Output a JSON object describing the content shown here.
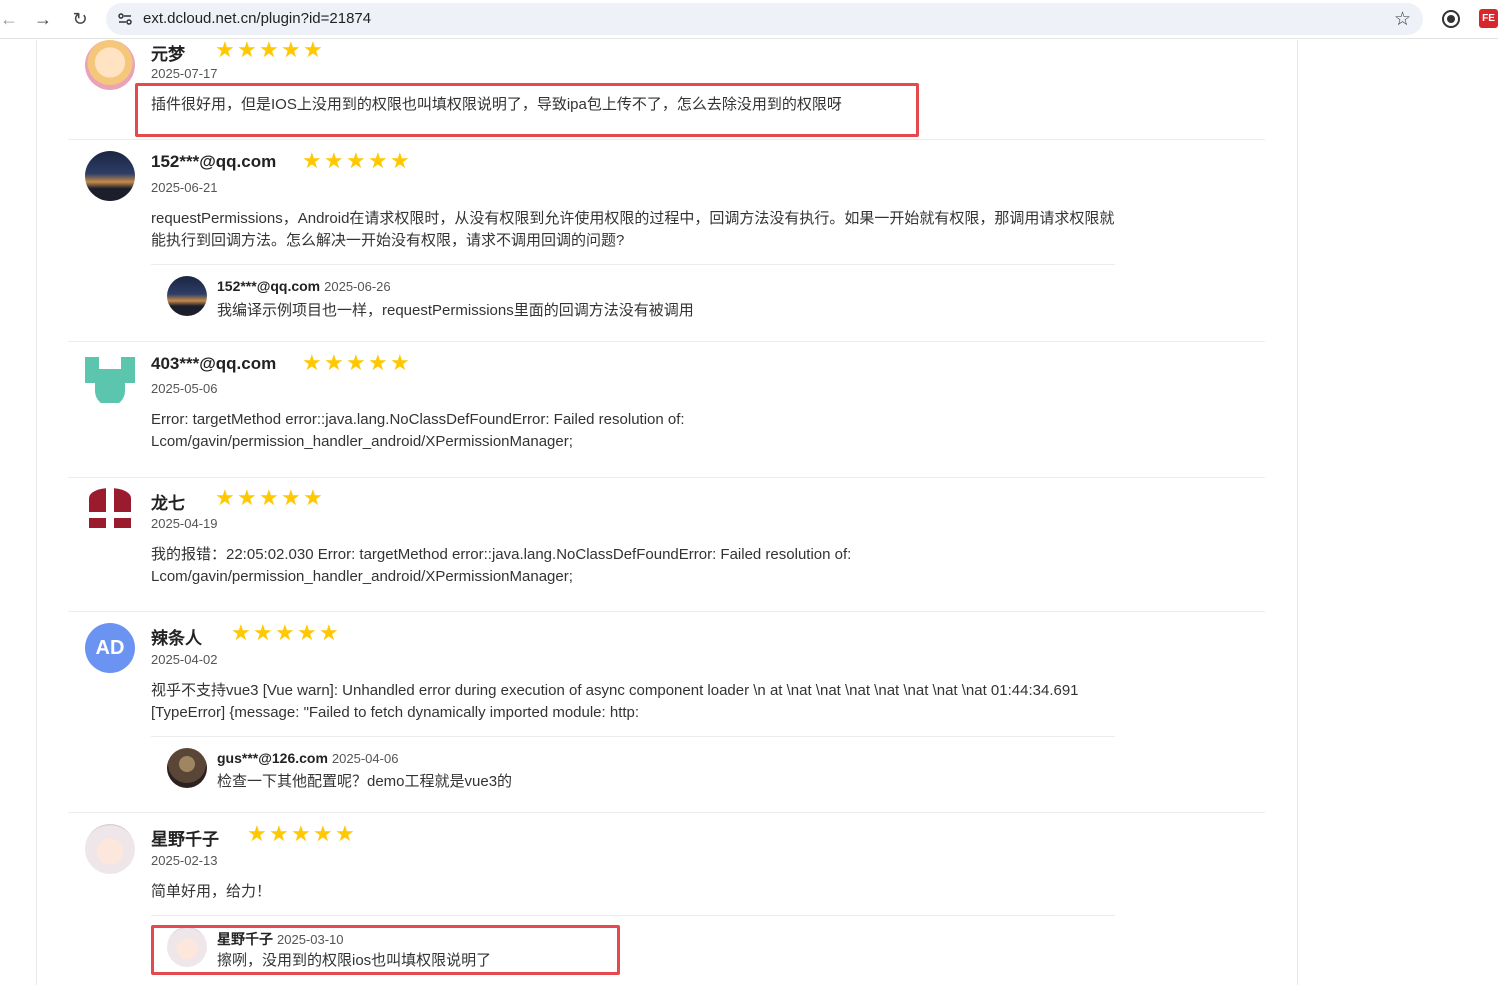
{
  "browser": {
    "url": "ext.dcloud.net.cn/plugin?id=21874",
    "back_icon": "arrow-left-icon",
    "forward_icon": "arrow-right-icon",
    "reload_icon": "reload-icon",
    "site_info_icon": "tune-icon",
    "bookmark_icon": "star-outline-icon",
    "extensions": [
      "circle-extension-icon",
      "fe-extension-icon"
    ],
    "ext2_label": "FE"
  },
  "reviews": [
    {
      "user": "元梦",
      "date": "2025-07-17",
      "rating": 5,
      "content": "插件很好用，但是IOS上没用到的权限也叫填权限说明了，导致ipa包上传不了，怎么去除没用到的权限呀",
      "highlighted": true
    },
    {
      "user": "152***@qq.com",
      "date": "2025-06-21",
      "rating": 5,
      "content": "requestPermissions，Android在请求权限时，从没有权限到允许使用权限的过程中，回调方法没有执行。如果一开始就有权限，那调用请求权限就能执行到回调方法。怎么解决一开始没有权限，请求不调用回调的问题?",
      "reply": {
        "user": "152***@qq.com",
        "date": "2025-06-26",
        "content": "我编译示例项目也一样，requestPermissions里面的回调方法没有被调用"
      }
    },
    {
      "user": "403***@qq.com",
      "date": "2025-05-06",
      "rating": 5,
      "content": "Error: targetMethod error::java.lang.NoClassDefFoundError: Failed resolution of: Lcom/gavin/permission_handler_android/XPermissionManager;"
    },
    {
      "user": "龙七",
      "date": "2025-04-19",
      "rating": 5,
      "content": "我的报错：22:05:02.030 Error: targetMethod error::java.lang.NoClassDefFoundError: Failed resolution of: Lcom/gavin/permission_handler_android/XPermissionManager;"
    },
    {
      "user": "辣条人",
      "date": "2025-04-02",
      "rating": 5,
      "avatar_text": "AD",
      "content": "视乎不支持vue3 [Vue warn]: Unhandled error during execution of async component loader \\n at \\nat \\nat \\nat \\nat \\nat \\nat \\nat 01:44:34.691 [TypeError] {message: \"Failed to fetch dynamically imported module: http:",
      "reply": {
        "user": "gus***@126.com",
        "date": "2025-04-06",
        "content": "检查一下其他配置呢？demo工程就是vue3的"
      }
    },
    {
      "user": "星野千子",
      "date": "2025-02-13",
      "rating": 5,
      "content": "简单好用，给力！",
      "reply": {
        "user": "星野千子",
        "date": "2025-03-10",
        "content": "擦咧，没用到的权限ios也叫填权限说明了",
        "highlighted": true
      }
    }
  ],
  "colors": {
    "star": "#ffc800",
    "highlight": "#e5484d"
  }
}
